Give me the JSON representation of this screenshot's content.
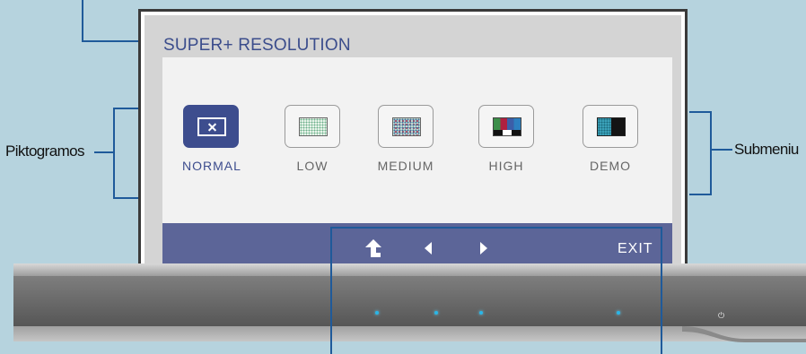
{
  "menu": {
    "title": "SUPER+ RESOLUTION",
    "options": [
      {
        "label": "NORMAL",
        "icon": "normal-icon",
        "selected": true
      },
      {
        "label": "LOW",
        "icon": "low-icon",
        "selected": false
      },
      {
        "label": "MEDIUM",
        "icon": "medium-icon",
        "selected": false
      },
      {
        "label": "HIGH",
        "icon": "high-icon",
        "selected": false
      },
      {
        "label": "DEMO",
        "icon": "demo-icon",
        "selected": false
      }
    ],
    "bar": {
      "up_icon": "up-arrow-icon",
      "left_icon": "left-arrow-icon",
      "right_icon": "right-arrow-icon",
      "exit_label": "EXIT"
    }
  },
  "callouts": {
    "left_label": "Piktogramos",
    "right_label": "Submeniu"
  },
  "bezel": {
    "power_icon": "power-icon"
  },
  "colors": {
    "accent": "#3d4d8e",
    "bar": "#5c6598",
    "led": "#29b6e8",
    "background": "#b6d3de"
  }
}
